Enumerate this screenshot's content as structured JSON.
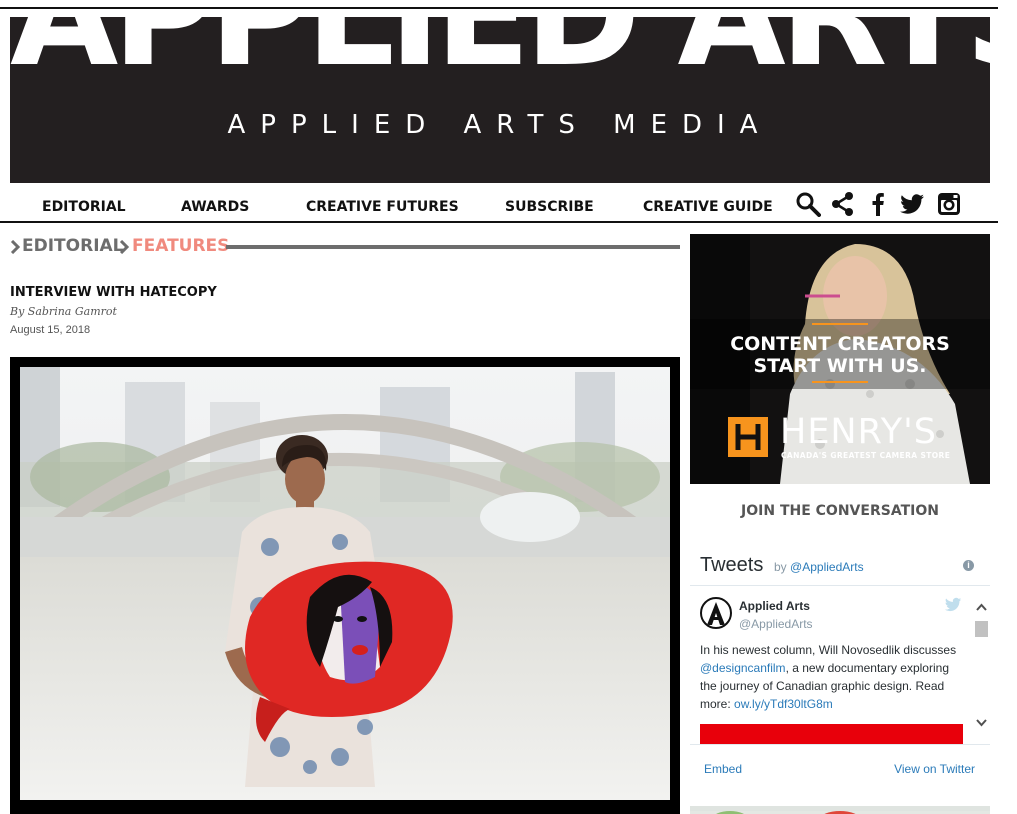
{
  "masthead": {
    "title": "APPLIED ARTS",
    "subtitle": "APPLIED ARTS MEDIA"
  },
  "nav": {
    "items": [
      "EDITORIAL",
      "AWARDS",
      "CREATIVE FUTURES",
      "SUBSCRIBE",
      "CREATIVE GUIDE"
    ],
    "icons": [
      "search-icon",
      "share-icon",
      "facebook-icon",
      "twitter-icon",
      "instagram-icon"
    ]
  },
  "breadcrumb": {
    "section": "EDITORIAL",
    "current": "FEATURES",
    "current_color": "#f08a7e"
  },
  "article": {
    "title": "INTERVIEW WITH HATECOPY",
    "byline": "By Sabrina Gamrot",
    "date": "August 15, 2018"
  },
  "ad": {
    "headline_1": "CONTENT CREATORS",
    "headline_2": "START WITH US.",
    "brand": "HENRY'S",
    "tagline": "CANADA'S GREATEST CAMERA STORE",
    "accent_color": "#f7941d"
  },
  "sidebar": {
    "join_heading": "JOIN THE CONVERSATION"
  },
  "twitter": {
    "title": "Tweets",
    "by_prefix": "by",
    "by_handle": "@AppliedArts",
    "tweet": {
      "name": "Applied Arts",
      "handle": "@AppliedArts",
      "text_1": "In his newest column, Will Novosedlik discusses",
      "mention": "@designcanfilm",
      "text_2": ", a new documentary exploring the journey of Canadian graphic design. Read more:",
      "link": "ow.ly/yTdf30ltG8m"
    },
    "embed_label": "Embed",
    "view_label": "View on Twitter",
    "link_color": "#2b7bb9"
  }
}
